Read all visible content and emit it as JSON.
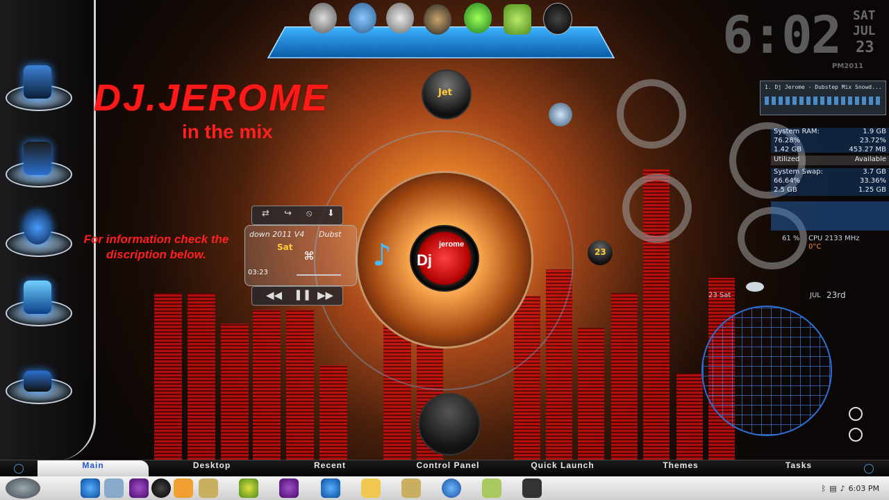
{
  "desktop": {
    "title": "DJ.JEROME",
    "subtitle": "in the mix",
    "info": "For information check the discription below."
  },
  "dock_top_icons": [
    "astronaut-icon",
    "alien-robot-icon",
    "alien-head-icon",
    "alien-ring-icon",
    "green-alien-icon",
    "android-icon",
    "alien-black-icon"
  ],
  "dock_left_icons": [
    "alienware-pc-icon",
    "alienware-laptop-icon",
    "sphere-icon",
    "recycle-bin-icon",
    "device-icon"
  ],
  "orb_labels": {
    "jet": "Jet",
    "day": "23"
  },
  "player": {
    "track": "down 2011 V4",
    "track2": "Dubst",
    "day": "Sat",
    "time": "03:23",
    "logo_text_1": "Dj",
    "logo_text_2": "jerome"
  },
  "clock": {
    "time": "6:02",
    "day": "SAT",
    "month": "JUL",
    "date": "23",
    "ampm_year": "PM2011"
  },
  "media_widget": {
    "now_playing": "1. Dj Jerome - Dubstep Mix Snowd..."
  },
  "system_stats": {
    "ram_label": "System RAM:",
    "ram_total": "1.9 GB",
    "ram_pct_used": "76.28%",
    "ram_pct_avail": "23.72%",
    "ram_used": "1.42 GB",
    "ram_avail": "453.27 MB",
    "utilized_label": "Utilized",
    "available_label": "Available",
    "swap_label": "System Swap:",
    "swap_total": "3.7 GB",
    "swap_pct_used": "66.64%",
    "swap_pct_avail": "33.36%",
    "swap_used": "2.5 GB",
    "swap_avail": "1.25 GB",
    "cpu_pct": "61 %",
    "cpu_label": "CPU 2133 MHz",
    "cpu_temp": "0°C"
  },
  "weather": {
    "date_small": "23 Sat",
    "month_small": "JUL",
    "date_big": "23rd"
  },
  "nav": {
    "items": [
      "Main",
      "Desktop",
      "Recent",
      "Control Panel",
      "Quick Launch",
      "Themes",
      "Tasks"
    ]
  },
  "taskbar": {
    "tray_time": "6:03 PM"
  }
}
